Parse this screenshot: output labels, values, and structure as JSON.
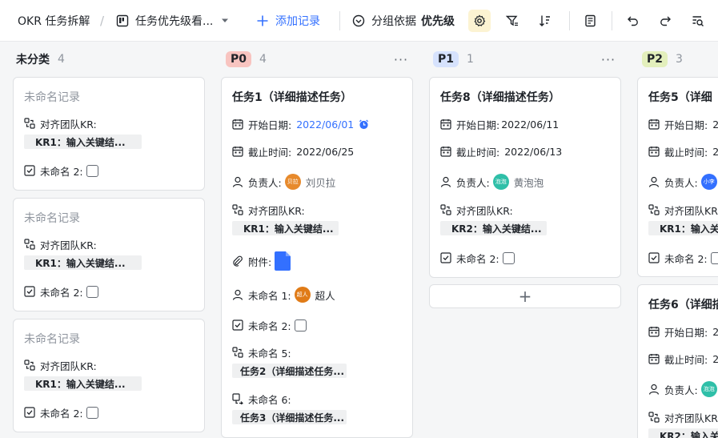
{
  "toolbar": {
    "title": "OKR 任务拆解",
    "separator": "/",
    "view_name": "任务优先级看...",
    "add_record": "添加记录",
    "group_label": "分组依据",
    "group_value": "优先级"
  },
  "colors": {
    "accent": "#3370ff",
    "p0_pill": "#f8c4c0",
    "p1_pill": "#d6e2fd",
    "p2_pill": "#e3efbc",
    "settings_active_bg": "#fcf3d2"
  },
  "columns": [
    {
      "title": "未分类",
      "count": "4"
    },
    {
      "title": "P0",
      "count": "4",
      "more": "···"
    },
    {
      "title": "P1",
      "count": "1",
      "more": "···"
    },
    {
      "title": "P2",
      "count": "3"
    }
  ],
  "cards": {
    "u1": {
      "title": "未命名记录",
      "kr_label": "对齐团队KR:",
      "kr_value": "KR1：输入关键结...",
      "cb_label": "未命名 2:"
    },
    "u2": {
      "title": "未命名记录",
      "kr_label": "对齐团队KR:",
      "kr_value": "KR1：输入关键结...",
      "cb_label": "未命名 2:"
    },
    "u3": {
      "title": "未命名记录",
      "kr_label": "对齐团队KR:",
      "kr_value": "KR1：输入关键结...",
      "cb_label": "未命名 2:"
    },
    "t1": {
      "title": "任务1（详细描述任务）",
      "start_label": "开始日期:",
      "start_value": "2022/06/01",
      "end_label": "截止时间:",
      "end_value": "2022/06/25",
      "owner_label": "负责人:",
      "owner_avatar": "贝拉",
      "owner_name": "刘贝拉",
      "kr_label": "对齐团队KR:",
      "kr_value": "KR1：输入关键结...",
      "attach_label": "附件:",
      "f1_label": "未命名 1:",
      "f1_avatar": "超人",
      "f1_name": "超人",
      "cb_label": "未命名 2:",
      "f5_label": "未命名 5:",
      "f5_value": "任务2（详细描述任务...",
      "f6_label": "未命名 6:",
      "f6_value": "任务3（详细描述任务..."
    },
    "t8": {
      "title": "任务8（详细描述任务）",
      "start_label": "开始日期:",
      "start_value": "2022/06/11",
      "end_label": "截止时间:",
      "end_value": "2022/06/13",
      "owner_label": "负责人:",
      "owner_avatar": "泡泡",
      "owner_name": "黄泡泡",
      "kr_label": "对齐团队KR:",
      "kr_value": "KR2：输入关键结...",
      "cb_label": "未命名 2:"
    },
    "t5": {
      "title": "任务5（详细",
      "start_label": "开始日期:",
      "start_value": "2",
      "end_label": "截止时间:",
      "end_value": "2",
      "owner_label": "负责人:",
      "owner_avatar": "小李",
      "kr_label": "对齐团队KR:",
      "kr_value": "KR1：输入关",
      "cb_label": "未命名 2:"
    },
    "t6": {
      "title": "任务6（详细描",
      "start_label": "开始日期:",
      "start_value": "2",
      "end_label": "截止时间:",
      "end_value": "2",
      "owner_label": "负责人:",
      "owner_avatar": "泡泡",
      "kr_label": "对齐团队KR:",
      "kr_value": "KR2：输入关"
    }
  },
  "add_card_symbol": "+"
}
